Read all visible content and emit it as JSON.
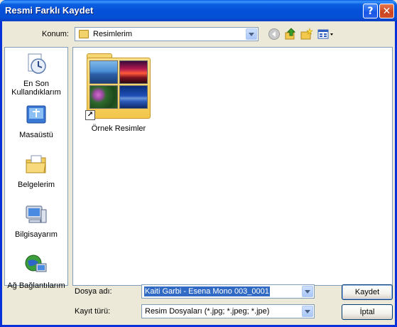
{
  "window": {
    "title": "Resmi Farklı Kaydet",
    "help_button": "?",
    "close_button": "✕"
  },
  "lookin": {
    "label": "Konum:",
    "value": "Resimlerim"
  },
  "toolbar": {
    "icons": [
      "back-icon",
      "up-folder-icon",
      "new-folder-icon",
      "view-menu-icon"
    ]
  },
  "places": [
    {
      "label_line1": "En Son",
      "label_line2": "Kullandıklarım",
      "icon": "recent-documents-icon"
    },
    {
      "label_line1": "Masaüstü",
      "label_line2": "",
      "icon": "desktop-icon"
    },
    {
      "label_line1": "Belgelerim",
      "label_line2": "",
      "icon": "my-documents-icon"
    },
    {
      "label_line1": "Bilgisayarım",
      "label_line2": "",
      "icon": "my-computer-icon"
    },
    {
      "label_line1": "Ağ Bağlantılarım",
      "label_line2": "",
      "icon": "network-places-icon"
    }
  ],
  "files": [
    {
      "name": "Örnek Resimler",
      "type": "folder-shortcut"
    }
  ],
  "filename": {
    "label": "Dosya adı:",
    "value": "Kaiti Garbi - Esena Mono 003_0001"
  },
  "filetype": {
    "label": "Kayıt türü:",
    "value": "Resim Dosyaları (*.jpg; *.jpeg; *.jpe)"
  },
  "buttons": {
    "save": "Kaydet",
    "cancel": "İptal"
  },
  "colors": {
    "titlebar": "#0a5fe0",
    "client": "#ece9d8",
    "selection": "#316ac5"
  }
}
